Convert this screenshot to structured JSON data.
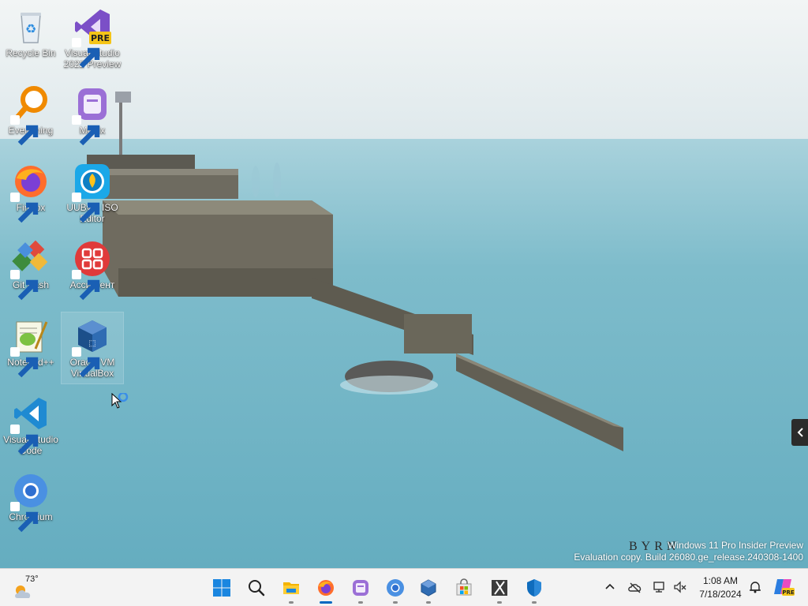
{
  "desktop_icons": [
    {
      "label": "Recycle Bin",
      "icon": "recycle-bin-icon"
    },
    {
      "label": "Visual Studio 2022 Preview",
      "icon": "visual-studio-icon",
      "badge": "PRE"
    },
    {
      "label": "Everything",
      "icon": "everything-icon"
    },
    {
      "label": "Motrix",
      "icon": "motrix-icon"
    },
    {
      "label": "Firefox",
      "icon": "firefox-icon"
    },
    {
      "label": "UUByte ISO Editor",
      "icon": "uubyte-icon"
    },
    {
      "label": "Git Bash",
      "icon": "git-bash-icon"
    },
    {
      "label": "Ассистент",
      "icon": "assistant-icon"
    },
    {
      "label": "Notepad++",
      "icon": "notepadpp-icon"
    },
    {
      "label": "Oracle VM VirtualBox",
      "icon": "virtualbox-icon"
    },
    {
      "label": "Visual Studio Code",
      "icon": "vscode-icon"
    },
    {
      "label": "Chromium",
      "icon": "chromium-icon"
    }
  ],
  "wallpaper": {
    "photo_credit": "BYRN",
    "watermark_line1": "Windows 11 Pro Insider Preview",
    "watermark_line2": "Evaluation copy. Build 26080.ge_release.240308-1400"
  },
  "taskbar": {
    "weather": {
      "temp": "73°",
      "icon": "weather-cloud-icon"
    },
    "apps": [
      {
        "name": "start-button",
        "icon": "windows-logo-icon"
      },
      {
        "name": "search-button",
        "icon": "search-icon"
      },
      {
        "name": "file-explorer",
        "icon": "folder-icon"
      },
      {
        "name": "firefox",
        "icon": "firefox-icon"
      },
      {
        "name": "motrix",
        "icon": "motrix-icon"
      },
      {
        "name": "chromium",
        "icon": "chromium-icon"
      },
      {
        "name": "virtualbox",
        "icon": "virtualbox-icon"
      },
      {
        "name": "microsoft-store",
        "icon": "store-icon"
      },
      {
        "name": "snipping-tool",
        "icon": "snipping-icon"
      },
      {
        "name": "windows-security",
        "icon": "shield-icon"
      }
    ],
    "tray": {
      "time": "1:08 AM",
      "date": "7/18/2024",
      "copilot_badge": "PRE"
    }
  },
  "colors": {
    "accent": "#0067c0",
    "taskbar_bg": "#f3f3f3"
  }
}
